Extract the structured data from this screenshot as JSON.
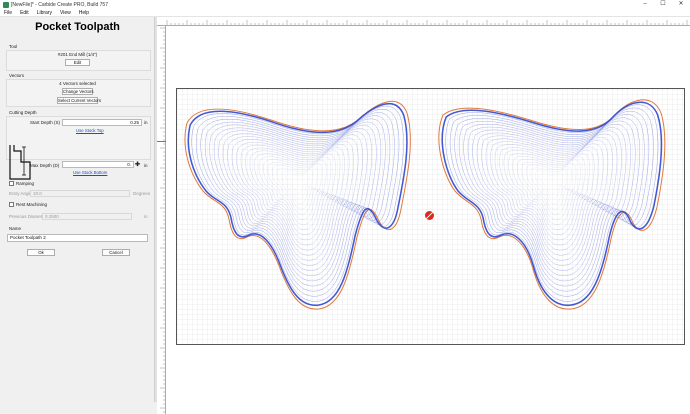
{
  "window": {
    "title": "[NewFile]* - Carbide Create PRO, Build 757",
    "controls": [
      "–",
      "☐",
      "✕"
    ]
  },
  "menu": [
    "File",
    "Edit",
    "Library",
    "View",
    "Help"
  ],
  "panel": {
    "title": "Pocket Toolpath",
    "tool": {
      "section_label": "Tool",
      "name": "#201 End Mill (1/4\")",
      "edit_label": "Edit"
    },
    "vectors": {
      "section_label": "Vectors",
      "status": "4 Vectors selected",
      "change_label": "Change Vectors",
      "select_current_label": "Select Current Vectors"
    },
    "cutting_depth": {
      "section_label": "Cutting Depth",
      "start_label": "Start Depth (S)",
      "start_value": "0.25",
      "start_unit": "in",
      "use_stock_top": "Use Stock Top",
      "max_label": "Max Depth (D)",
      "max_value": "0.",
      "max_unit": "in",
      "use_stock_bottom": "Use Stock Bottom"
    },
    "ramping": {
      "label": "Ramping",
      "checked": false,
      "entry_angle_label": "Entry Angle",
      "entry_angle_value": "10.0",
      "entry_angle_unit": "Degrees"
    },
    "rest_machining": {
      "label": "Rest Machining",
      "checked": false,
      "previous_diameter_label": "Previous Diameter",
      "previous_diameter_value": "0.2500",
      "previous_diameter_unit": "in"
    },
    "name": {
      "section_label": "Name",
      "value": "Pocket Toolpath 2"
    },
    "ok_label": "Ok",
    "cancel_label": "Cancel"
  },
  "colors": {
    "toolpath": "#3a4fd0",
    "outline": "#e07a3a",
    "grid": "#d7d7d7",
    "accent": "#1a4fc8"
  },
  "icons": [
    "app-icon",
    "add-icon",
    "origin-marker-icon"
  ]
}
